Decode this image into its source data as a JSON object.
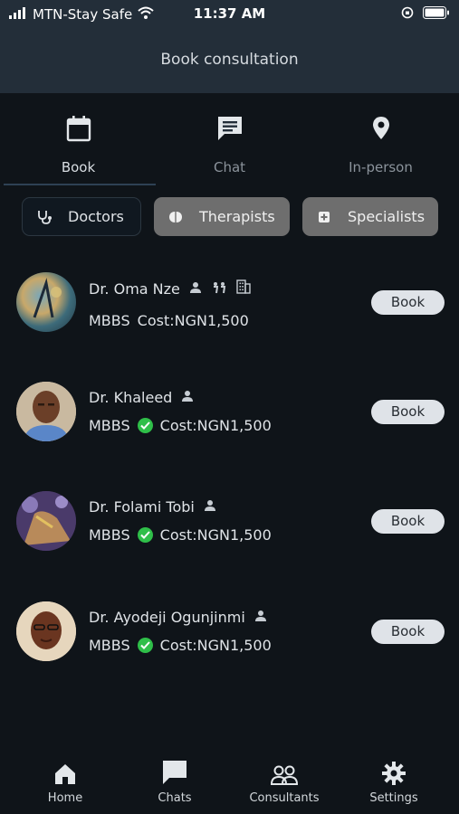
{
  "status_bar": {
    "carrier": "MTN-Stay Safe",
    "time": "11:37 AM",
    "icons": [
      "signal-icon",
      "wifi-icon",
      "orientation-lock-icon",
      "battery-icon"
    ]
  },
  "header": {
    "title": "Book consultation"
  },
  "tabs": [
    {
      "label": "Book",
      "icon": "calendar-icon",
      "active": true
    },
    {
      "label": "Chat",
      "icon": "chat-icon",
      "active": false
    },
    {
      "label": "In-person",
      "icon": "location-pin-icon",
      "active": false
    }
  ],
  "filters": [
    {
      "label": "Doctors",
      "icon": "stethoscope-icon",
      "selected": true
    },
    {
      "label": "Therapists",
      "icon": "brain-icon",
      "selected": false
    },
    {
      "label": "Specialists",
      "icon": "medical-plus-icon",
      "selected": false
    }
  ],
  "consultants": [
    {
      "name": "Dr. Oma Nze",
      "qualification": "MBBS",
      "cost": "Cost:NGN1,500",
      "verified": false,
      "icons": [
        "person-icon",
        "walking-icon",
        "building-icon"
      ],
      "book_label": "Book"
    },
    {
      "name": "Dr. Khaleed",
      "qualification": "MBBS",
      "cost": "Cost:NGN1,500",
      "verified": true,
      "icons": [
        "person-icon"
      ],
      "book_label": "Book"
    },
    {
      "name": "Dr. Folami Tobi",
      "qualification": "MBBS",
      "cost": "Cost:NGN1,500",
      "verified": true,
      "icons": [
        "person-icon"
      ],
      "book_label": "Book"
    },
    {
      "name": "Dr. Ayodeji Ogunjinmi",
      "qualification": "MBBS",
      "cost": "Cost:NGN1,500",
      "verified": true,
      "icons": [
        "person-icon"
      ],
      "book_label": "Book"
    }
  ],
  "bottom_nav": [
    {
      "label": "Home",
      "icon": "home-icon"
    },
    {
      "label": "Chats",
      "icon": "chat-bubble-icon"
    },
    {
      "label": "Consultants",
      "icon": "people-icon"
    },
    {
      "label": "Settings",
      "icon": "gear-icon"
    }
  ],
  "colors": {
    "background": "#0f1419",
    "header": "#232e39",
    "verified": "#2fbf49",
    "book_button": "#dfe3e8",
    "filter_gray": "#6e6e6e"
  }
}
